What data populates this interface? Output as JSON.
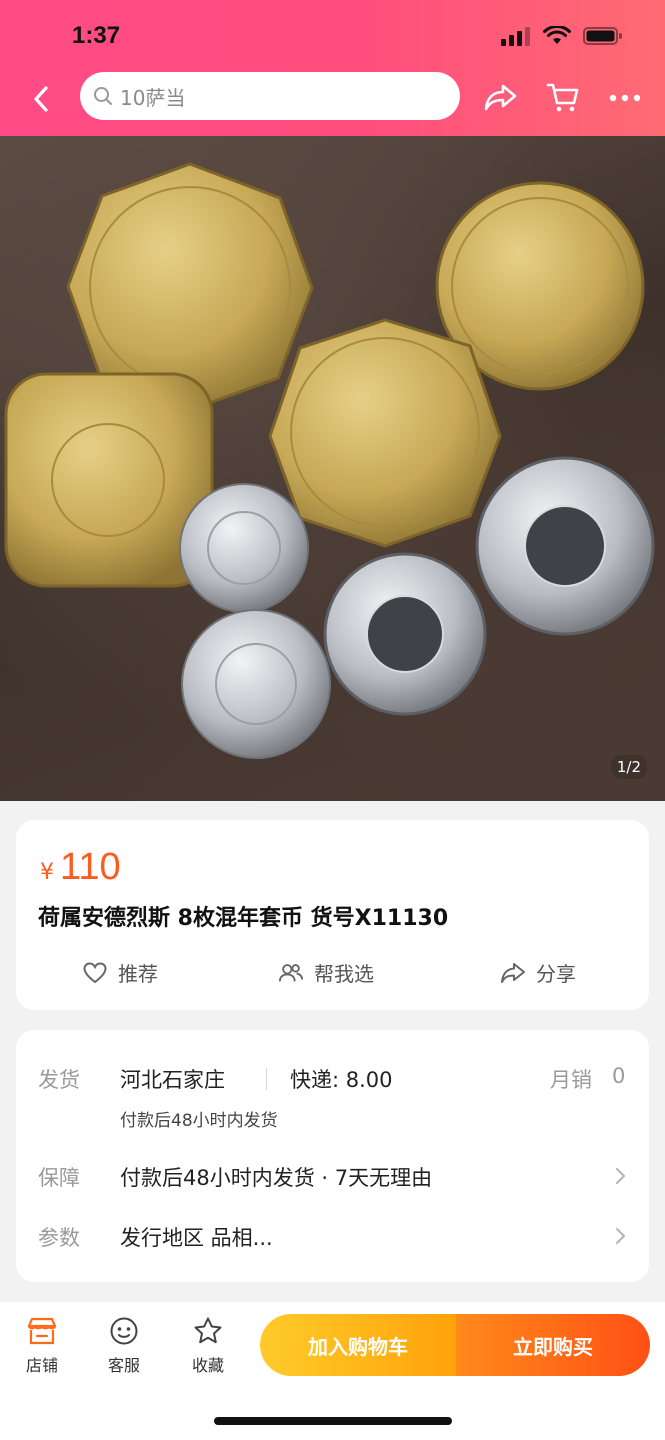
{
  "status_bar": {
    "time": "1:37"
  },
  "nav": {
    "search_text": "10萨当",
    "icons": [
      "back-icon",
      "search-icon",
      "share-icon",
      "cart-icon",
      "more-icon"
    ]
  },
  "gallery": {
    "counter": "1/2"
  },
  "product": {
    "currency": "¥",
    "price": "110",
    "title": "荷属安德烈斯 8枚混年套币 货号X11130",
    "actions": [
      {
        "label": "推荐",
        "icon": "heart-icon"
      },
      {
        "label": "帮我选",
        "icon": "people-icon"
      },
      {
        "label": "分享",
        "icon": "share-icon"
      }
    ]
  },
  "details": {
    "shipping": {
      "label": "发货",
      "location": "河北石家庄",
      "express": "快递: 8.00",
      "monthly_sales_label": "月销",
      "monthly_sales_value": "0",
      "note": "付款后48小时内发货"
    },
    "guarantee": {
      "label": "保障",
      "value": "付款后48小时内发货 · 7天无理由"
    },
    "params": {
      "label": "参数",
      "value": "发行地区 品相..."
    }
  },
  "bottom_bar": {
    "tabs": [
      {
        "label": "店铺",
        "icon": "shop-icon"
      },
      {
        "label": "客服",
        "icon": "service-icon"
      },
      {
        "label": "收藏",
        "icon": "star-icon"
      }
    ],
    "add_to_cart": "加入购物车",
    "buy_now": "立即购买"
  },
  "colors": {
    "header_start": "#ff4b86",
    "header_end": "#ff6b73",
    "price": "#ff5a1f",
    "cart_button": "#ffb31a",
    "buy_button": "#ff6a18"
  }
}
